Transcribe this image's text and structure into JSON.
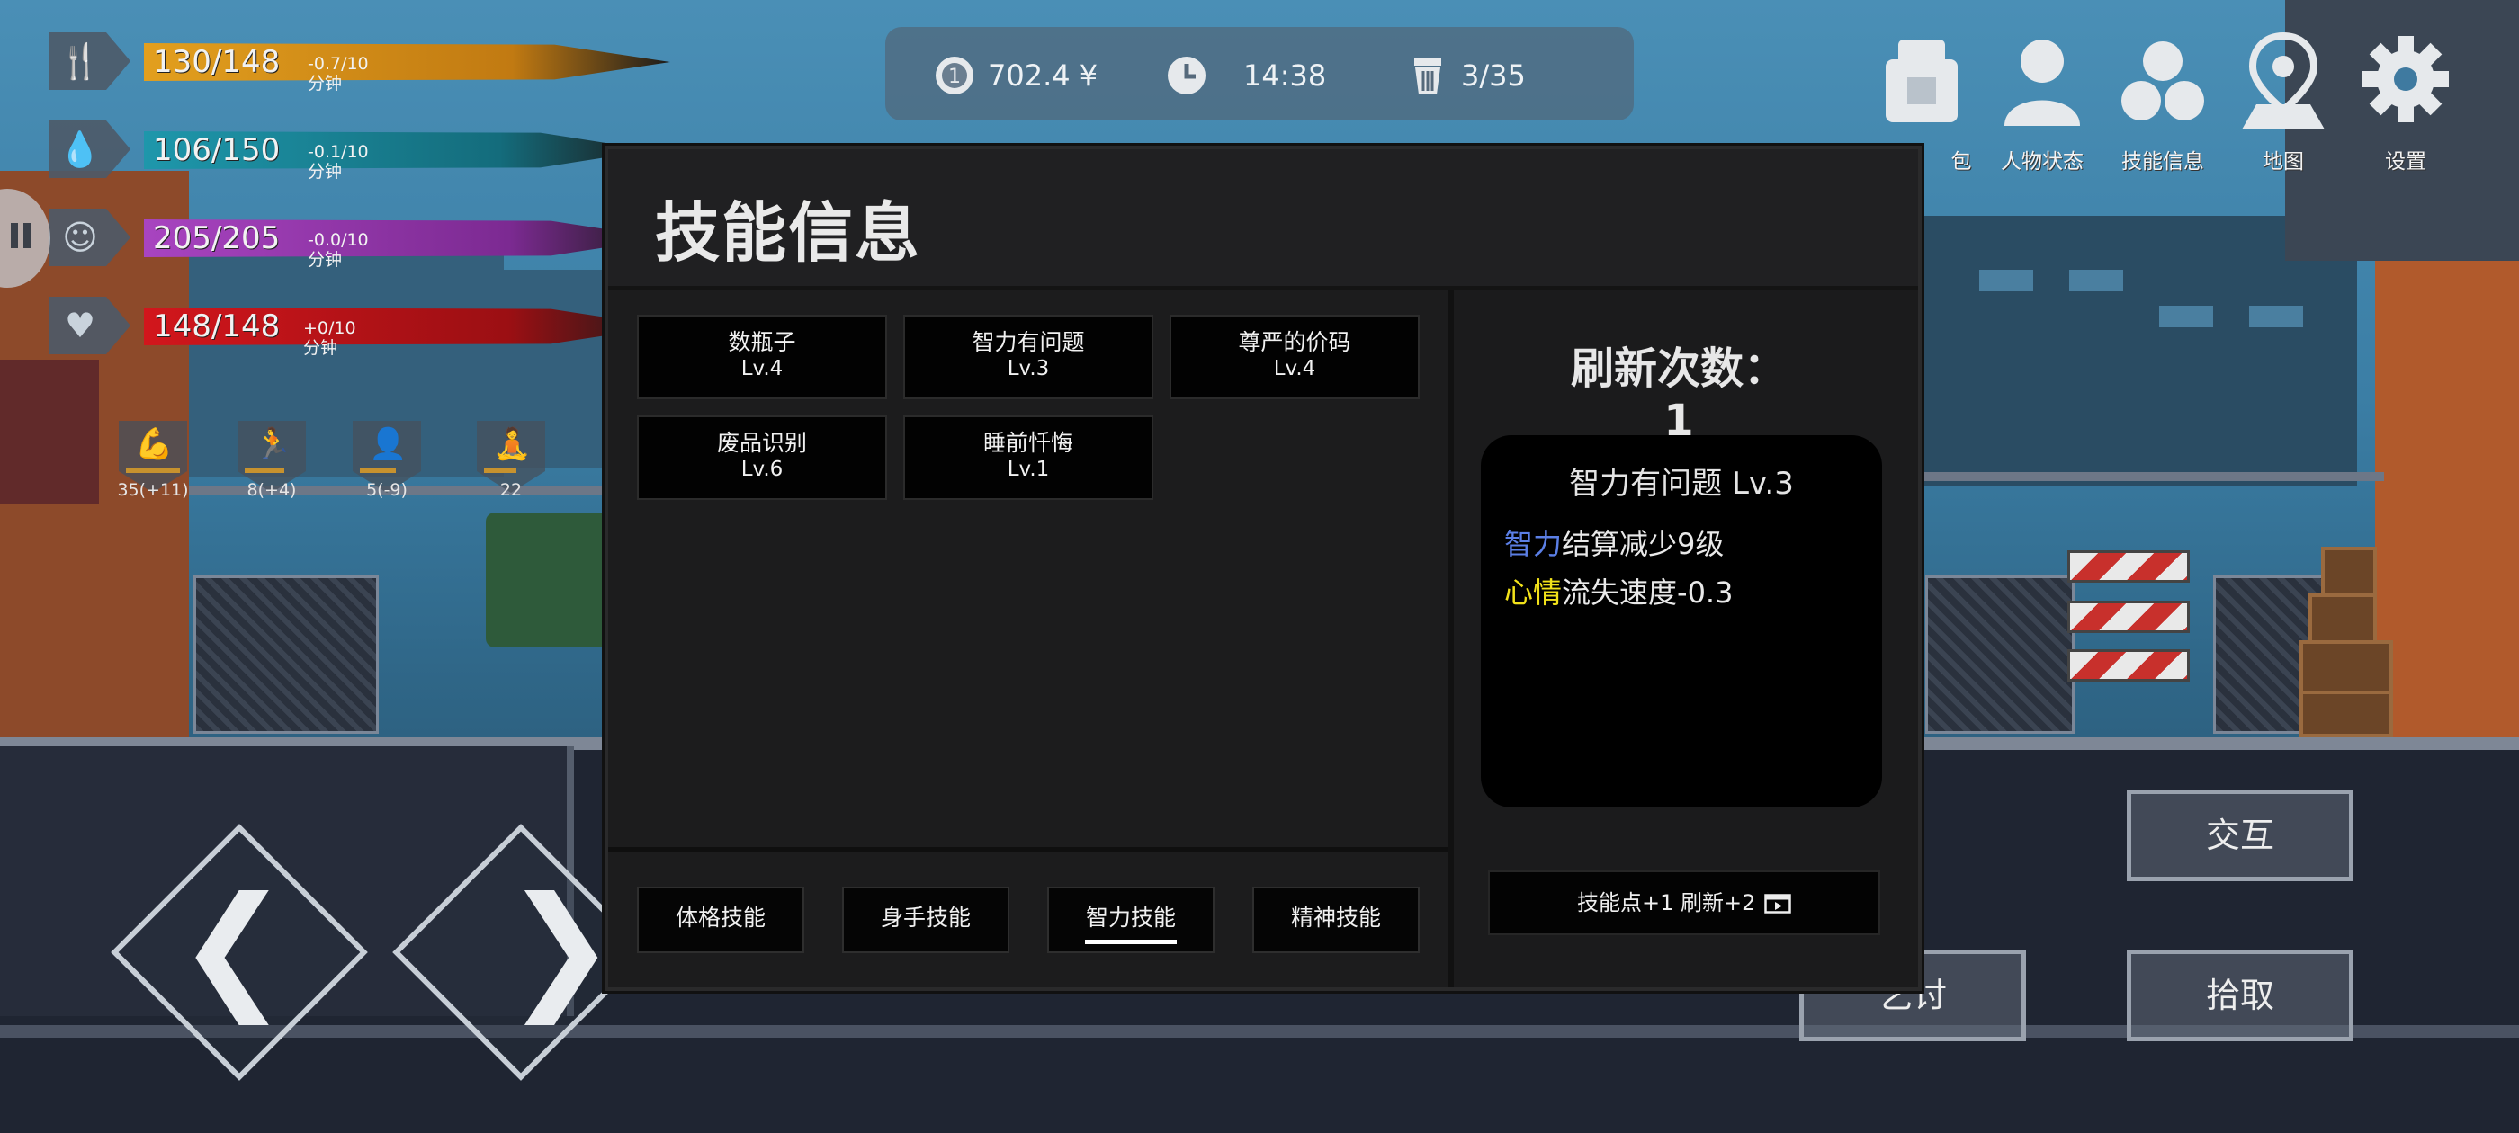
{
  "stats": [
    {
      "icon": "fork-knife-icon",
      "value": "130/148",
      "rate": "-0.7/10分钟",
      "color": "#d9951f"
    },
    {
      "icon": "water-drop-icon",
      "value": "106/150",
      "rate": "-0.1/10分钟",
      "color": "#1f8fa4"
    },
    {
      "icon": "face-icon",
      "value": "205/205",
      "rate": "-0.0/10分钟",
      "color": "#a03ab8"
    },
    {
      "icon": "heartbeat-icon",
      "value": "148/148",
      "rate": "+0/10分钟",
      "color": "#c8141a"
    }
  ],
  "attributes": [
    {
      "icon": "muscle-icon",
      "value": "35(+11)"
    },
    {
      "icon": "running-icon",
      "value": "8(+4)"
    },
    {
      "icon": "head-icon",
      "value": "5(-9)"
    },
    {
      "icon": "meditate-icon",
      "value": "22"
    }
  ],
  "top_bar": {
    "money": "702.4 ¥",
    "time": "14:38",
    "bag": "3/35"
  },
  "menu": [
    "包",
    "人物状态",
    "技能信息",
    "地图",
    "设置"
  ],
  "actions": {
    "interact": "交互",
    "beg": "乞讨",
    "pickup": "拾取"
  },
  "panel": {
    "title": "技能信息",
    "skills": [
      {
        "name": "数瓶子",
        "level": "Lv.4"
      },
      {
        "name": "智力有问题",
        "level": "Lv.3"
      },
      {
        "name": "尊严的价码",
        "level": "Lv.4"
      },
      {
        "name": "废品识别",
        "level": "Lv.6"
      },
      {
        "name": "睡前忏悔",
        "level": "Lv.1"
      }
    ],
    "tabs": [
      "体格技能",
      "身手技能",
      "智力技能",
      "精神技能"
    ],
    "active_tab": "智力技能",
    "refresh_count": "刷新次数：1",
    "detail": {
      "title": "智力有问题 Lv.3",
      "effects": [
        {
          "keyword": "智力",
          "keyword_color": "#5b7fe6",
          "text": "结算减少9级"
        },
        {
          "keyword": "心情",
          "keyword_color": "#f2e21a",
          "text": "流失速度-0.3"
        }
      ]
    },
    "refresh_button": "技能点+1 刷新+2"
  }
}
